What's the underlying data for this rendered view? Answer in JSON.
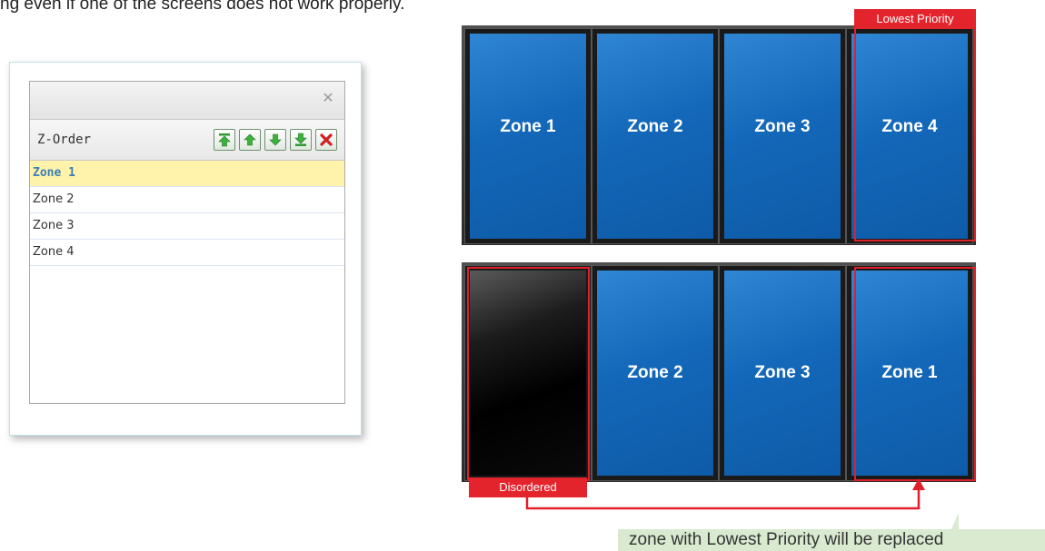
{
  "intro_text": "ng even if one of the screens does not work properly.",
  "dialog": {
    "close_glyph": "✕",
    "toolbar_label": "Z-Order",
    "toolbar_buttons": [
      {
        "icon": "move-to-top-icon",
        "color": "#2f9a2f"
      },
      {
        "icon": "move-up-icon",
        "color": "#2f9a2f"
      },
      {
        "icon": "move-down-icon",
        "color": "#2f9a2f"
      },
      {
        "icon": "move-to-bottom-icon",
        "color": "#2f9a2f"
      },
      {
        "icon": "delete-icon",
        "color": "#d02020"
      }
    ],
    "zones": [
      "Zone 1",
      "Zone 2",
      "Zone 3",
      "Zone 4"
    ],
    "selected_zone": "Zone 1"
  },
  "wall_top": {
    "screens": [
      "Zone 1",
      "Zone 2",
      "Zone 3",
      "Zone 4"
    ],
    "tag": "Lowest Priority"
  },
  "wall_bottom": {
    "screens": [
      "",
      "Zone 2",
      "Zone 3",
      "Zone 1"
    ],
    "tag": "Disordered"
  },
  "note": "zone with Lowest Priority will be replaced",
  "colors": {
    "accent_red": "#e4242c",
    "screen_blue": "#1468b9",
    "note_bg": "#d9ead0",
    "selected_row": "#fff2aa"
  }
}
